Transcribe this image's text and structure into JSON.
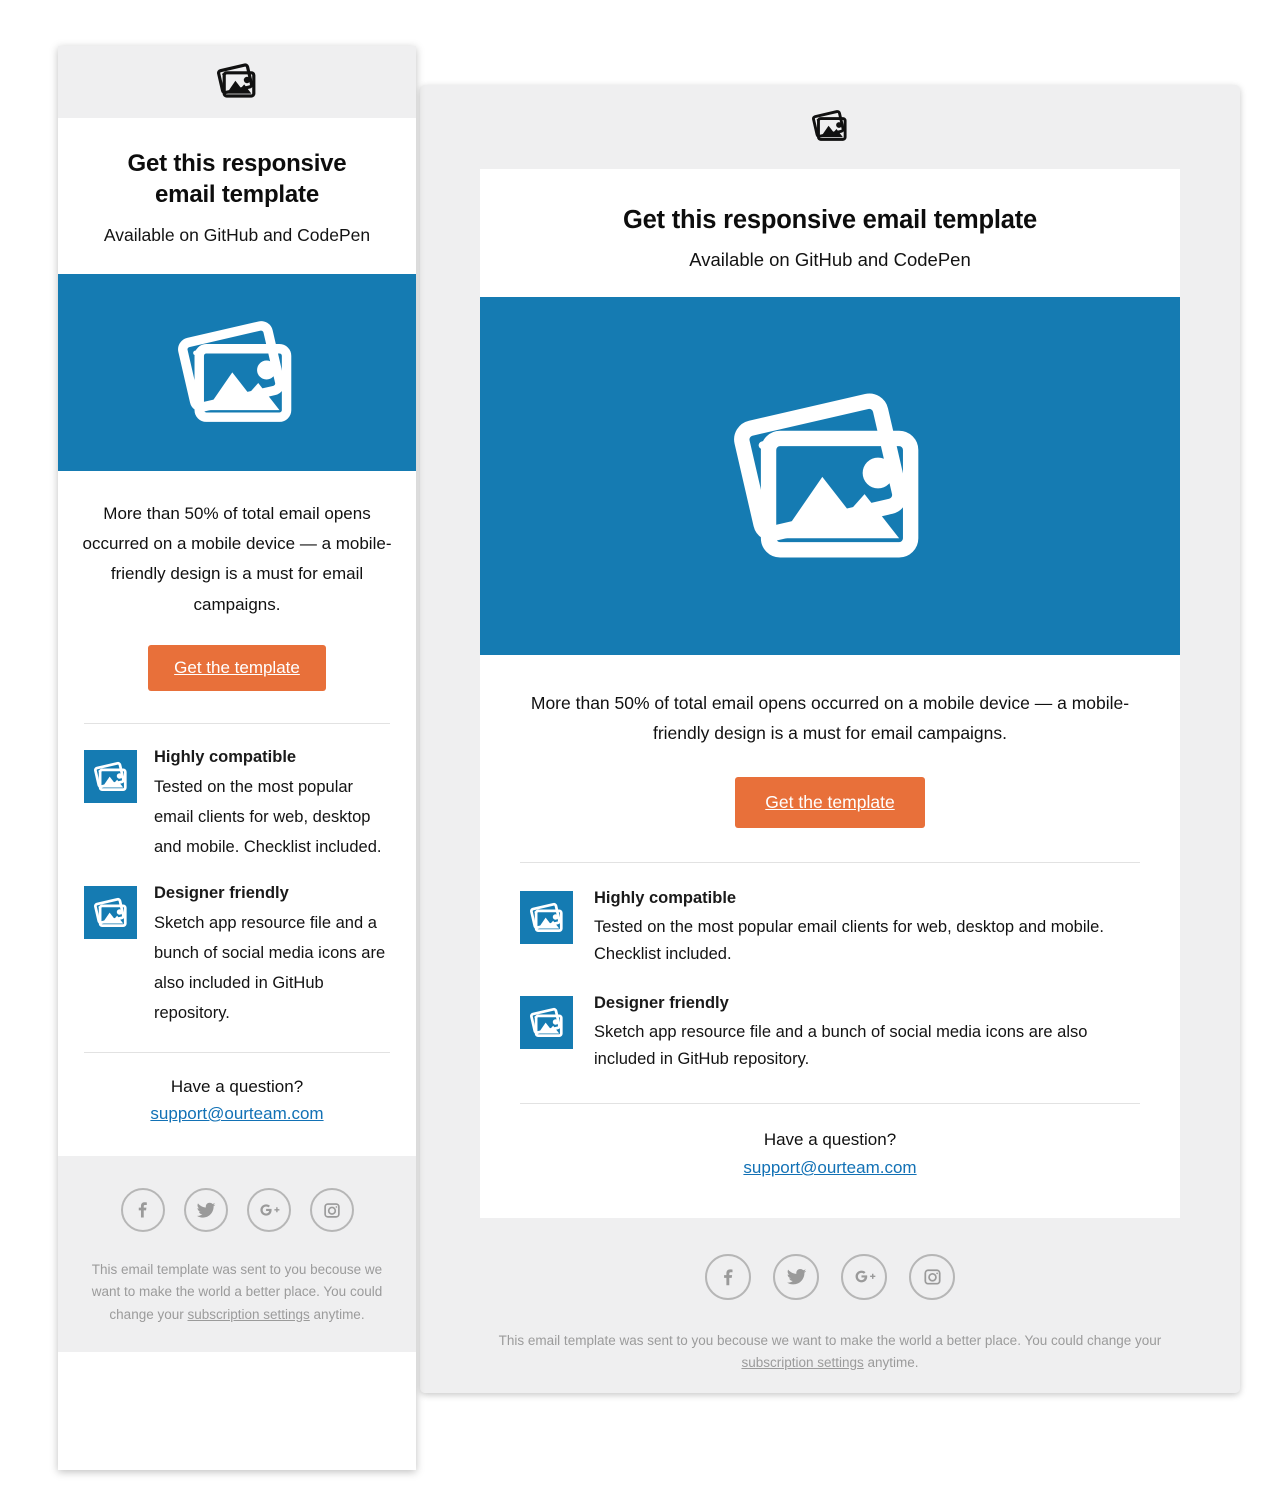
{
  "brand": {
    "logo_icon": "photos-icon",
    "accent_blue": "#157bb2",
    "accent_orange": "#e8703a",
    "link_blue": "#1271b5",
    "panel_gray": "#efeff0"
  },
  "email": {
    "title": "Get this responsive email template",
    "title_mobile_line1": "Get this responsive",
    "title_mobile_line2": "email template",
    "subtitle": "Available on GitHub and CodePen",
    "hero_icon": "photos-icon",
    "lead": "More than 50% of total email opens occurred on a mobile device — a mobile-friendly design is a must for email campaigns.",
    "cta_label": "Get the template",
    "features": [
      {
        "icon": "photos-icon",
        "title": "Highly compatible",
        "body": "Tested on the most popular email clients for web, desktop and mobile. Checklist included."
      },
      {
        "icon": "photos-icon",
        "title": "Designer friendly",
        "body": "Sketch app resource file and a bunch of social media icons are also included in GitHub repository."
      }
    ],
    "question": {
      "prompt": "Have a question?",
      "email": "support@ourteam.com"
    },
    "social": [
      {
        "name": "facebook-icon",
        "glyph": "f"
      },
      {
        "name": "twitter-icon",
        "glyph": "t"
      },
      {
        "name": "google-plus-icon",
        "glyph": "g+"
      },
      {
        "name": "instagram-icon",
        "glyph": "i"
      }
    ],
    "legal": {
      "before": "This email template was sent to you becouse we want to make the world a better place. You could change your ",
      "link": "subscription settings",
      "after": " anytime."
    }
  }
}
